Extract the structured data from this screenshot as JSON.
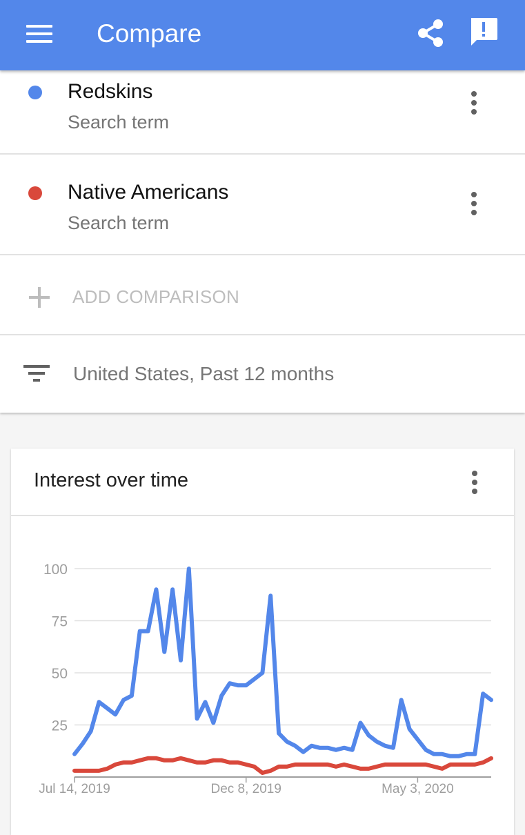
{
  "appbar": {
    "title": "Compare",
    "icons": [
      "menu-icon",
      "share-icon",
      "feedback-icon"
    ],
    "color": "#5387ea"
  },
  "terms": [
    {
      "name": "Redskins",
      "subtitle": "Search term",
      "color": "#5387ea"
    },
    {
      "name": "Native Americans",
      "subtitle": "Search term",
      "color": "#d9483b"
    }
  ],
  "add_comparison": {
    "label": "ADD COMPARISON"
  },
  "filter": {
    "label": "United States, Past 12 months"
  },
  "card": {
    "title": "Interest over time"
  },
  "chart_data": {
    "type": "line",
    "title": "Interest over time",
    "ylim": [
      0,
      100
    ],
    "yticks": [
      25,
      50,
      75,
      100
    ],
    "xtick_labels": [
      "Jul 14, 2019",
      "Dec 8, 2019",
      "May 3, 2020"
    ],
    "grid": true,
    "x": [
      "Jul 14, 2019",
      "Jul 21, 2019",
      "Jul 28, 2019",
      "Aug 4, 2019",
      "Aug 11, 2019",
      "Aug 18, 2019",
      "Aug 25, 2019",
      "Sep 1, 2019",
      "Sep 8, 2019",
      "Sep 15, 2019",
      "Sep 22, 2019",
      "Sep 29, 2019",
      "Oct 6, 2019",
      "Oct 13, 2019",
      "Oct 20, 2019",
      "Oct 27, 2019",
      "Nov 3, 2019",
      "Nov 10, 2019",
      "Nov 17, 2019",
      "Nov 24, 2019",
      "Dec 1, 2019",
      "Dec 8, 2019",
      "Dec 15, 2019",
      "Dec 22, 2019",
      "Dec 29, 2019",
      "Jan 5, 2020",
      "Jan 12, 2020",
      "Jan 19, 2020",
      "Jan 26, 2020",
      "Feb 2, 2020",
      "Feb 9, 2020",
      "Feb 16, 2020",
      "Feb 23, 2020",
      "Mar 1, 2020",
      "Mar 8, 2020",
      "Mar 15, 2020",
      "Mar 22, 2020",
      "Mar 29, 2020",
      "Apr 5, 2020",
      "Apr 12, 2020",
      "Apr 19, 2020",
      "Apr 26, 2020",
      "May 3, 2020",
      "May 10, 2020",
      "May 17, 2020",
      "May 24, 2020",
      "May 31, 2020",
      "Jun 7, 2020",
      "Jun 14, 2020",
      "Jun 21, 2020",
      "Jun 28, 2020",
      "Jul 5, 2020"
    ],
    "series": [
      {
        "name": "Redskins",
        "color": "#5387ea",
        "values": [
          11,
          16,
          22,
          36,
          33,
          30,
          37,
          39,
          70,
          70,
          90,
          60,
          90,
          56,
          100,
          28,
          36,
          26,
          39,
          45,
          44,
          44,
          47,
          50,
          87,
          21,
          17,
          15,
          12,
          15,
          14,
          14,
          13,
          14,
          13,
          26,
          20,
          17,
          15,
          14,
          37,
          23,
          18,
          13,
          11,
          11,
          10,
          10,
          11,
          11,
          40,
          37
        ]
      },
      {
        "name": "Native Americans",
        "color": "#d9483b",
        "values": [
          3,
          3,
          3,
          3,
          4,
          6,
          7,
          7,
          8,
          9,
          9,
          8,
          8,
          9,
          8,
          7,
          7,
          8,
          8,
          7,
          7,
          6,
          5,
          2,
          3,
          5,
          5,
          6,
          6,
          6,
          6,
          6,
          5,
          6,
          5,
          4,
          4,
          5,
          6,
          6,
          6,
          6,
          6,
          6,
          5,
          4,
          6,
          6,
          6,
          6,
          7,
          9
        ]
      }
    ]
  }
}
